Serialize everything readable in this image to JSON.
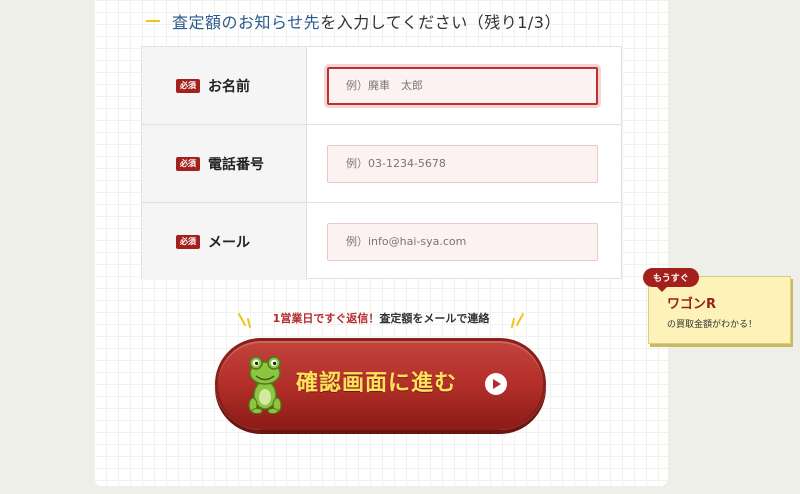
{
  "form": {
    "heading_highlight": "査定額のお知らせ先",
    "heading_rest": "を入力してください（残り1/3）",
    "fields": [
      {
        "required": "必須",
        "label": "お名前",
        "placeholder": "例）廃車　太郎"
      },
      {
        "required": "必須",
        "label": "電話番号",
        "placeholder": "例）03-1234-5678"
      },
      {
        "required": "必須",
        "label": "メール",
        "placeholder": "例）info@hai-sya.com"
      }
    ]
  },
  "notice": {
    "highlight": "1営業日ですぐ返信！",
    "rest": "査定額をメールで連絡"
  },
  "cta": {
    "label": "確認画面に進む"
  },
  "promo": {
    "tag": "もうすぐ",
    "title": "ワゴンR",
    "text": "の買取金額がわかる！"
  },
  "colors": {
    "accent_red": "#a3201c",
    "cta_text_yellow": "#fde25c",
    "heading_blue": "#2b5a8c",
    "promo_bg": "#fdf3b8"
  },
  "icons": [
    "frog-mascot-icon",
    "arrow-right-circle-icon",
    "sparkle-icon"
  ]
}
